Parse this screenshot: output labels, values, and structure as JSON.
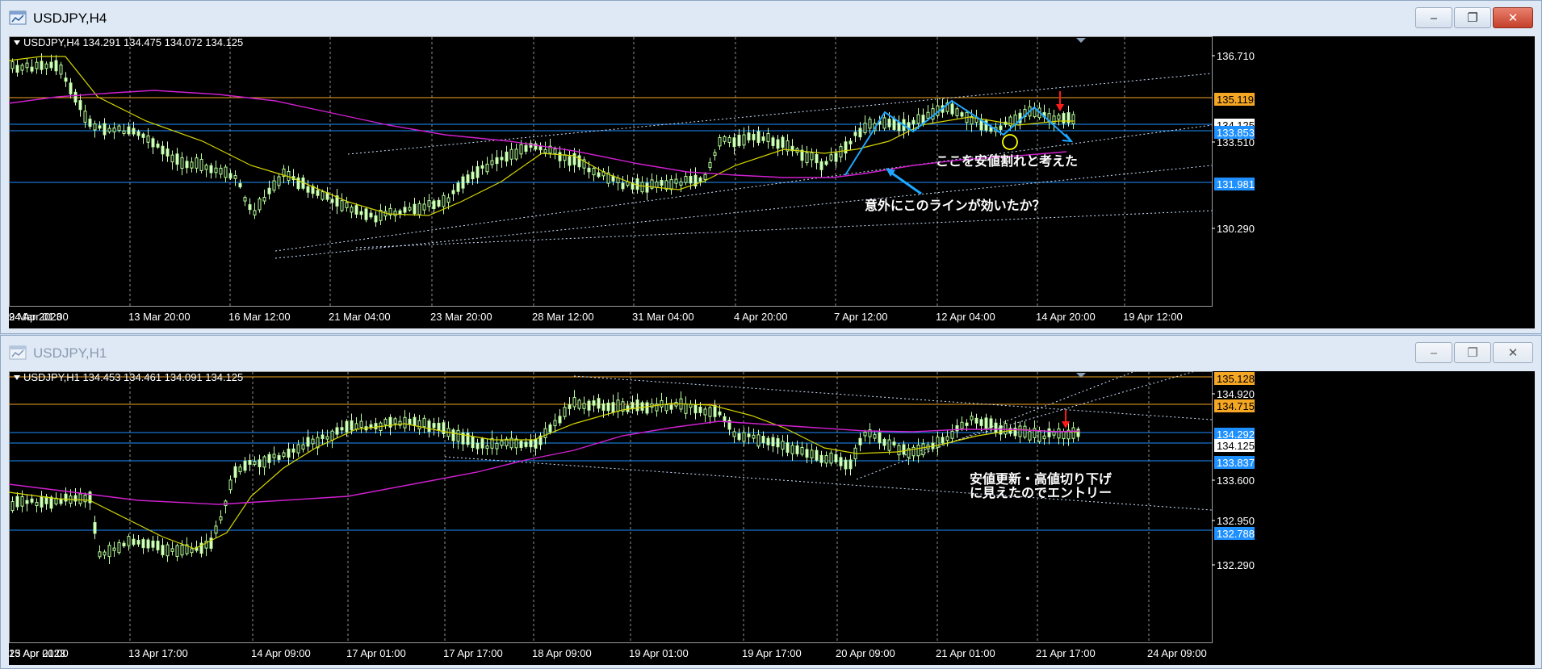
{
  "windows": [
    {
      "id": "h4",
      "title": "USDJPY,H4",
      "active": true,
      "buttons": {
        "minimize": "‒",
        "maximize": "❐",
        "close": "✕"
      },
      "info_line": "USDJPY,H4  134.291 134.475 134.072 134.125",
      "price_scale": [
        "136.710",
        "135.119",
        "134.125",
        "133.853",
        "133.510",
        "131.981",
        "130.290"
      ],
      "level_tags": [
        {
          "value": "135.119",
          "color": "#f5a623",
          "text_color": "#000000"
        },
        {
          "value": "134.125",
          "color": "#ffffff",
          "text_color": "#000000"
        },
        {
          "value": "133.853",
          "color": "#1e90ff",
          "text_color": "#ffffff"
        },
        {
          "value": "131.981",
          "color": "#1e90ff",
          "text_color": "#ffffff"
        }
      ],
      "time_labels": [
        "9 Mar 2023",
        "13 Mar 20:00",
        "16 Mar 12:00",
        "21 Mar 04:00",
        "23 Mar 20:00",
        "28 Mar 12:00",
        "31 Mar 04:00",
        "4 Apr 20:00",
        "7 Apr 12:00",
        "12 Apr 04:00",
        "14 Apr 20:00",
        "19 Apr 12:00",
        "24 Apr 01:00"
      ],
      "annotations": [
        "ここを安値割れと考えた",
        "意外にこのラインが効いたか？"
      ]
    },
    {
      "id": "h1",
      "title": "USDJPY,H1",
      "active": false,
      "buttons": {
        "minimize": "‒",
        "maximize": "❐",
        "close": "✕"
      },
      "info_line": "USDJPY,H1  134.453 134.461 134.091 134.125",
      "price_scale": [
        "135.128",
        "134.920",
        "134.715",
        "134.292",
        "134.125",
        "133.837",
        "133.600",
        "132.950",
        "132.788",
        "132.290"
      ],
      "level_tags": [
        {
          "value": "135.128",
          "color": "#f5a623",
          "text_color": "#000000"
        },
        {
          "value": "134.715",
          "color": "#f5a623",
          "text_color": "#000000"
        },
        {
          "value": "134.292",
          "color": "#1e90ff",
          "text_color": "#ffffff"
        },
        {
          "value": "134.125",
          "color": "#ffffff",
          "text_color": "#000000"
        },
        {
          "value": "133.837",
          "color": "#1e90ff",
          "text_color": "#ffffff"
        },
        {
          "value": "132.788",
          "color": "#1e90ff",
          "text_color": "#ffffff"
        }
      ],
      "time_labels": [
        "13 Apr 2023",
        "13 Apr 17:00",
        "14 Apr 09:00",
        "17 Apr 01:00",
        "17 Apr 17:00",
        "18 Apr 09:00",
        "19 Apr 01:00",
        "19 Apr 17:00",
        "20 Apr 09:00",
        "21 Apr 01:00",
        "21 Apr 17:00",
        "24 Apr 09:00",
        "25 Apr 01:00"
      ],
      "annotations": [
        "安値更新・高値切り下げ",
        "に見えたのでエントリー"
      ]
    }
  ],
  "colors": {
    "bull_candle": "#b9ff9a",
    "bear_candle": "#d8ffc8",
    "ma_fast": "#d6d600",
    "ma_slow": "#d020d0",
    "support_line": "#1e90ff",
    "resistance_line": "#f5a623",
    "grid": "#ffffff",
    "arrow_red": "#ff1a1a",
    "arrow_cyan": "#1ea7ff",
    "zigzag": "#1ea7ff",
    "circle": "#ffff00"
  }
}
